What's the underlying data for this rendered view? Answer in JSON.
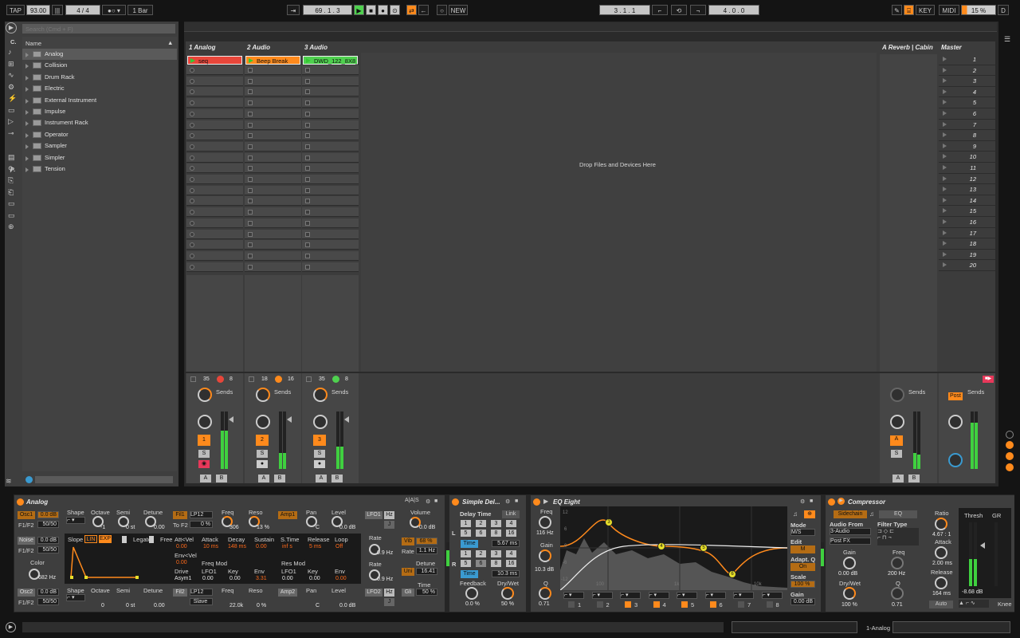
{
  "transport": {
    "tap": "TAP",
    "tempo": "93.00",
    "sig": "4 / 4",
    "quant": "1 Bar",
    "position": "69 .   1 .   3",
    "new": "NEW",
    "loop_start": "3 .   1 .   1",
    "loop_len": "4 .   0 .   0",
    "key": "KEY",
    "midi": "MIDI",
    "cpu": "15 %",
    "d": "D"
  },
  "browser": {
    "search_placeholder": "Search (Cmd + F)",
    "cat1": "C.",
    "cat2": "P.",
    "name_header": "Name",
    "items": [
      "Analog",
      "Collision",
      "Drum Rack",
      "Electric",
      "External Instrument",
      "Impulse",
      "Instrument Rack",
      "Operator",
      "Sampler",
      "Simpler",
      "Tension"
    ]
  },
  "session": {
    "drop_hint": "Drop Files and Devices Here",
    "tracks": [
      {
        "name": "1 Analog",
        "clip": "seq",
        "n1": "35",
        "n2": "8",
        "num": "1"
      },
      {
        "name": "2 Audio",
        "clip": "Beep Break",
        "n1": "18",
        "n2": "16",
        "num": "2"
      },
      {
        "name": "3 Audio",
        "clip": "DWD_122_8X8_",
        "n1": "35",
        "n2": "8",
        "num": "3"
      }
    ],
    "returns": {
      "name": "A Reverb | Cabin",
      "letter": "A"
    },
    "master": {
      "name": "Master",
      "post": "Post"
    },
    "scenes": [
      "1",
      "2",
      "3",
      "4",
      "5",
      "6",
      "7",
      "8",
      "9",
      "10",
      "11",
      "12",
      "13",
      "14",
      "15",
      "16",
      "17",
      "18",
      "19",
      "20"
    ],
    "sends": "Sends",
    "a": "A",
    "b": "B",
    "s": "S"
  },
  "analog": {
    "title": "Analog",
    "osc1": "Osc1",
    "osc1_val": "0.0 dB",
    "f1f2": "F1/F2",
    "f1f2_val": "50/50",
    "shape": "Shape",
    "octave": "Octave",
    "octave_val": "-1",
    "semi": "Semi",
    "semi_val": "0 st",
    "detune": "Detune",
    "detune_val": "0.00",
    "fil1": "Fil1",
    "lp12": "LP12",
    "tof2": "To F2",
    "tof2_val": "0 %",
    "freq": "Freq",
    "freq_val": "306",
    "reso": "Reso",
    "reso_val": "13 %",
    "amp1": "Amp1",
    "pan": "Pan",
    "pan_val": "C",
    "level": "Level",
    "level_val": "0.0 dB",
    "lfo1": "LFO1",
    "hz": "Hz",
    "j": "J",
    "rate": "Rate",
    "rate_val": "0.9 Hz",
    "noise": "Noise",
    "noise_val": "0.0 dB",
    "noise_f": "50/50",
    "color": "Color",
    "color_val": "682 Hz",
    "env_slope": "Slope",
    "lin": "LIN",
    "exp": "EXP",
    "legato": "Legato",
    "free": "Free",
    "attvel": "Att<Vel",
    "attvel_val": "0.00",
    "attack": "Attack",
    "attack_val": "10 ms",
    "decay": "Decay",
    "decay_val": "148 ms",
    "sustain": "Sustain",
    "sustain_val": "0.00",
    "stime": "S.Time",
    "stime_val": "inf s",
    "release": "Release",
    "release_val": "5 ms",
    "loop": "Loop",
    "loop_val": "Off",
    "envvel": "Env<Vel",
    "envvel_val": "0.00",
    "drive": "Drive",
    "drive_val": "Asym1",
    "freqmod": "Freq Mod",
    "lfo1b": "LFO1",
    "lfo1b_val": "0.00",
    "key": "Key",
    "key_val": "0.00",
    "env": "Env",
    "env_val": "3.31",
    "resmod": "Res Mod",
    "lfo1c_val": "0.00",
    "key2_val": "0.00",
    "env2_val": "0.00",
    "osc2": "Osc2",
    "osc2_val": "0.0 dB",
    "f1f2b_val": "50/50",
    "octave2_val": "0",
    "semi2_val": "0 st",
    "detune2_val": "0.00",
    "fil2": "Fil2",
    "lp12b": "LP12",
    "slave": "Slave",
    "freq2_val": "22.0k",
    "reso2_val": "0 %",
    "amp2": "Amp2",
    "pan2_val": "C",
    "level2_val": "0.0 dB",
    "lfo2": "LFO2",
    "rate2_val": "0.9 Hz",
    "volume": "Volume",
    "volume_val": "0.0 dB",
    "vib": "Vib",
    "vib_val": "68 %",
    "rate3": "Rate",
    "rate3_val": "1.1 Hz",
    "detune3": "Detune",
    "uni": "Uni",
    "uni_val": "16.41",
    "time": "Time",
    "gli": "Gli",
    "gli_val": "50 %"
  },
  "delay": {
    "title": "Simple Del...",
    "delay_time": "Delay Time",
    "link": "Link",
    "grid": [
      "1",
      "2",
      "3",
      "4",
      "5",
      "6",
      "8",
      "16"
    ],
    "time": "Time",
    "l_val": "5.67 ms",
    "r_val": "10.3 ms",
    "l": "L",
    "r": "R",
    "feedback": "Feedback",
    "feedback_val": "0.0 %",
    "drywet": "Dry/Wet",
    "drywet_val": "50 %"
  },
  "eq": {
    "title": "EQ Eight",
    "freq": "Freq",
    "freq_val": "116 Hz",
    "gain": "Gain",
    "gain_val": "10.3 dB",
    "q": "Q",
    "q_val": "0.71",
    "mode": "Mode",
    "mode_val": "M/S",
    "edit": "Edit",
    "edit_val": "M",
    "adaptq": "Adapt. Q",
    "adaptq_val": "On",
    "scale": "Scale",
    "scale_val": "100 %",
    "gain2": "Gain",
    "gain2_val": "0.00 dB",
    "bands": [
      "1",
      "2",
      "3",
      "4",
      "5",
      "6",
      "7",
      "8"
    ],
    "grid_labels": [
      "12",
      "6",
      "0",
      "-6",
      "-12"
    ],
    "f_labels": [
      "100",
      "1k",
      "10k"
    ],
    "dots": [
      "3",
      "4",
      "5",
      "6"
    ]
  },
  "comp": {
    "title": "Compressor",
    "sidechain": "Sidechain",
    "eq": "EQ",
    "audio_from": "Audio From",
    "audio_from_val": "3-Audio",
    "postfx": "Post FX",
    "filter_type": "Filter Type",
    "gain": "Gain",
    "gain_val": "0.00 dB",
    "freq": "Freq",
    "freq_val": "200 Hz",
    "drywet": "Dry/Wet",
    "drywet_val": "100 %",
    "q": "Q",
    "q_val": "0.71",
    "ratio": "Ratio",
    "ratio_val": "4.67 : 1",
    "attack": "Attack",
    "attack_val": "2.00 ms",
    "release": "Release",
    "release_val": "164 ms",
    "auto": "Auto",
    "thresh": "Thresh",
    "gr": "GR",
    "thresh_val": "-8.68 dB",
    "knee": "Knee"
  },
  "status": {
    "track": "1-Analog"
  }
}
